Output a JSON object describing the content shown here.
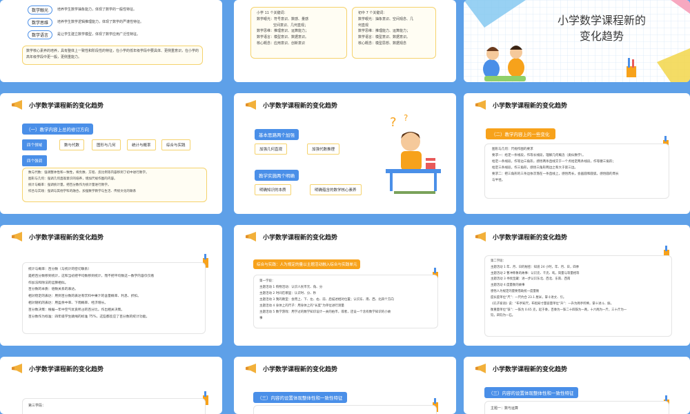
{
  "slide1": {
    "tags": [
      {
        "tag": "数学眼光",
        "text": "培养学生数学抽象能力，体现了数学的一般性特征。"
      },
      {
        "tag": "数学思维",
        "text": "培养学生数学逻辑推理能力，体现了数学的严谨性特征。"
      },
      {
        "tag": "数学语言",
        "text": "是让学生建立数学模型，体现了数学应用广泛性特征。"
      }
    ],
    "note": "数学核心素养的培养，具有整体上一致性和阶段性的特征，在小学的低年级学段中要具体、更侧重意识，在小学的高年级学段中更一般，更侧重能力。"
  },
  "slide2": {
    "left_title": "小学 11 个关键词：",
    "left_lines": [
      "数学眼光：符号意识、数感、量感",
      "空间意识、几何直观；",
      "数学思维：推理意识、运算能力；",
      "数学语言：模型意识、数据意识。",
      "核心概念：应用意识、创新意识"
    ],
    "right_title": "初中 7 个关键词：",
    "right_lines": [
      "数学眼光：抽象意识、空间观念、几",
      "何直观",
      "数学思维：推理能力、运算能力；",
      "数学语言：模型意识、数据意识。",
      "核心概念：模型思想、数据观念"
    ]
  },
  "cover": {
    "title_line1": "小学数学课程新的",
    "title_line2": "变化趋势"
  },
  "common_title": "小学数学课程新的变化趋势",
  "slide4": {
    "heading": "（一）教学内容上总的修订方向",
    "sub1": "四个领域",
    "domains": [
      "数与代数",
      "图形与几何",
      "统计与概率",
      "综合与实践"
    ],
    "sub2": "四个强调",
    "lines": [
      "数与代数：强调整体性和一致性，将负数、方程、反比例等内容移到了初中进行教学。",
      "图形与几何：强调几何直观意识的培养，增加尺规作图的内容。",
      "统计与概率：强调统计量，把百分数作为统计量进行教学。",
      "综合与实践：强调与其他学科的融合，加强数学教学与生活、传统文化的联系"
    ]
  },
  "slide5": {
    "label1": "基本思路两个加强",
    "items1": [
      "加强几何直观",
      "加强代数推理"
    ],
    "label2": "教学实施两个明确",
    "items2": [
      "明确知识的本质",
      "明确蕴含的数学核心素养"
    ]
  },
  "slide6": {
    "heading": "（二）教学内容上的一些变化",
    "lines": [
      "图形与几何：尺规作图的要求",
      "要求一：给定一条线段，作等长线段，理解几何概念（类似数学）。",
      "给定一条线段，作等边三角形，感悟两条直线交于一个点给定两条线段，作等腰三角形；",
      "给定三条线段，作三角形，感悟三角形两边之和大于第三边。",
      "要求二：把三角形的三条边依次落在一条直线上，感悟周长，会画圆和圆弧，感悟圆的周长",
      "与半径。"
    ]
  },
  "slide7": {
    "lines": [
      "统计与概率：百分数（与统计的密切联系）",
      "是把百分数移到统计，这和当初把平均数移到统计，而不把平均数这一数学内容仅仅看",
      "作加法和除法的运算相似。",
      "百分数的本质：倍数关系的表达。",
      "相对稳定的表达：用到百分数的表达有饮料中果汁的含量概率、利息、折扣。",
      "相对随机的表达：用盈余中率、下雨概率、经济增长。",
      "百分数决策：根据一年中空气优良所占的百分比，作出相关决策。",
      "百分数作为标准：四年级学生跳绳的标准 75%，这些都反应了百分数的统计功能。"
    ]
  },
  "slide8": {
    "heading": "综合与实践：人为规定的量以主题活动融入综合与实践单元",
    "lines": [
      "第一学段：",
      "主题活动 1 购物活动：认识人民币元、角、分",
      "主题活动 2 时间在哪里：认识时、分、秒",
      "主题活动 3 我的教室：会用上、下、左、右、前、后描述相对位置；认识东、南、西、北四个方向",
      "主题活动 4 身体上的尺子：用身体上的“长度”为单位进行测量",
      "主题活动 5 数学游戏：用学过的数学知识设计一关的拍币，或者，还设一个含有数学知识的小故",
      "事"
    ]
  },
  "slide9": {
    "lines": [
      "第二学段：",
      "主题活动 1 年、月、日的秘密：知道 24 小时，年、月、日，四季",
      "主题活动 2 曹冲称象的故事：认识克、千克、吨，简量与等量相等",
      "主题活动 3 寻找宝藏：进一步认识东北、西北、东南、西南",
      "主题活动 4 度量衡的故事",
      "感悟人为规定的量要借助统一度量衡",
      "度长度单位“尺”：一尺约合 23.1 厘米，掌十进丈、引。",
      "《孔子家语》说：“布手知尺，布指知寸量容量单位“升”：一升为两手所捧，掌十进斗、斛。",
      "衡重量单位“铢”：一铢为 0.65 克，起于黍，百黍为一铢二十四铢为一两，十六两为一斤，三十斤为一",
      "钧，四钧为一石。"
    ]
  },
  "slide10": {
    "line": "第三学段："
  },
  "slide11": {
    "heading": "（三）内容的设置体现整体性和一致性特征"
  },
  "slide12": {
    "heading": "（三）内容的设置体现整体性和一致性特征",
    "line": "主题一：数与运算"
  }
}
